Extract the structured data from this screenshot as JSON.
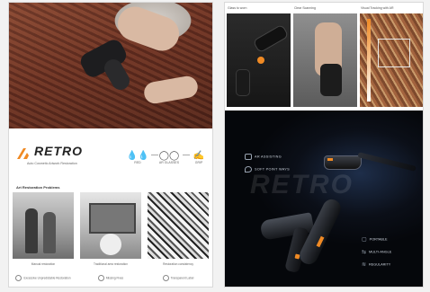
{
  "brand": {
    "name": "RETRO",
    "tagline": "Auto Cosmetic Artwork Restoration",
    "accent_color": "#f08a24"
  },
  "features": [
    {
      "icon": "drops-icon",
      "label": "RED"
    },
    {
      "icon": "glasses-icon",
      "label": "AR GLASSES"
    },
    {
      "icon": "hand-icon",
      "label": "GRIP"
    }
  ],
  "left_section": {
    "title": "Art Restoration Problems",
    "items": [
      {
        "caption": "Manual restoration",
        "footer": "Excessive Unpredictable Restoration"
      },
      {
        "caption": "Traditional area restoration",
        "footer": "Missing Fixes"
      },
      {
        "caption": "Restoration consistency",
        "footer": "Transparent Label"
      }
    ]
  },
  "right_top": {
    "headers": [
      "Glass to worn",
      "Clear Scanning",
      "Visual Tracking with AR"
    ]
  },
  "specs_left": [
    {
      "icon": "ar-icon",
      "label": "AR ASSISTING"
    },
    {
      "icon": "location-icon",
      "label": "SOFT POINT WAYS"
    }
  ],
  "specs_right": [
    {
      "icon": "portable-icon",
      "label": "PORTABLE"
    },
    {
      "icon": "multi-angle-icon",
      "label": "MULTI-ANGLE"
    },
    {
      "icon": "drops-icon",
      "label": "REGULARITY"
    }
  ],
  "ghost_wordmark": "RETRO"
}
